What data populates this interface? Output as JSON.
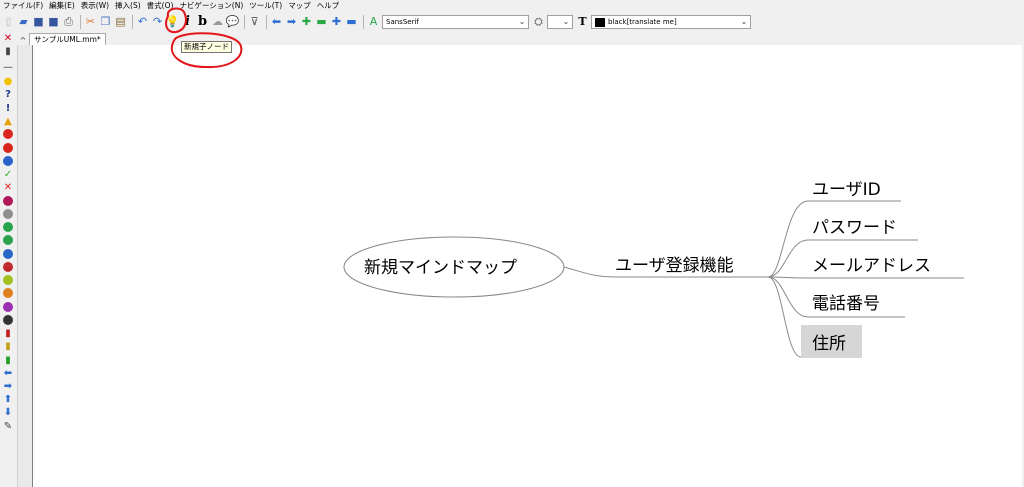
{
  "menu": [
    "ファイル(F)",
    "編集(E)",
    "表示(W)",
    "挿入(S)",
    "書式(O)",
    "ナビゲーション(N)",
    "ツール(T)",
    "マップ",
    "ヘルプ"
  ],
  "toolbar": {
    "font_family": "SansSerif",
    "font_size": "",
    "color_label": "black[translate me]",
    "tooltip": "新規子ノード"
  },
  "tab": {
    "label": "サンプルUML.mm*"
  },
  "mindmap": {
    "root": "新規マインドマップ",
    "branch": "ユーザ登録機能",
    "children": [
      "ユーザID",
      "パスワード",
      "メールアドレス",
      "電話番号",
      "住所"
    ],
    "selected_child": "住所"
  },
  "colors": {
    "highlight": "#d6d6d6",
    "annotation_circle": "#e0161b",
    "edge": "#8a8a8a"
  }
}
